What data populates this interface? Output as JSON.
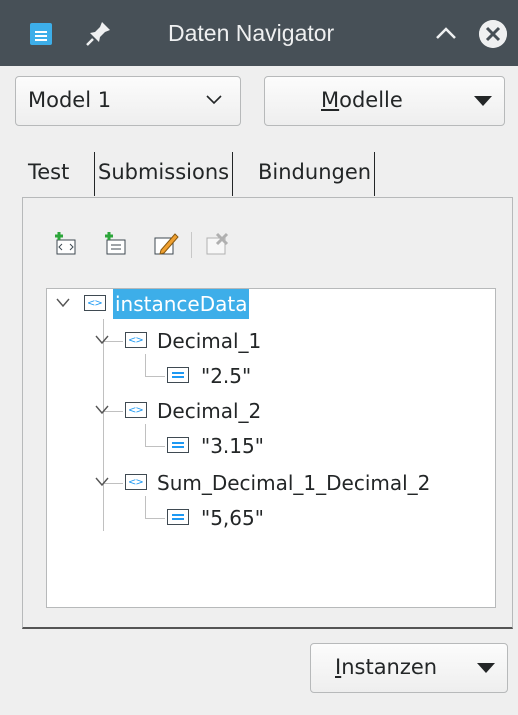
{
  "window": {
    "title": "Daten Navigator",
    "icons": [
      "app-icon",
      "pin-icon",
      "collapse-up-icon",
      "close-icon"
    ]
  },
  "model_select": {
    "value": "Model 1"
  },
  "models_button": {
    "label_mnemonic": "M",
    "label_rest": "odelle"
  },
  "tabs": [
    {
      "label": "Test",
      "active": true
    },
    {
      "label": "Submissions",
      "active": false
    },
    {
      "label": "Bindungen",
      "active": false
    }
  ],
  "toolbar": {
    "icons": [
      "add-item-icon",
      "add-element-icon",
      "edit-icon",
      "delete-icon"
    ]
  },
  "tree": {
    "root": "instanceData",
    "children": [
      {
        "name": "Decimal_1",
        "value": "\"2.5\""
      },
      {
        "name": "Decimal_2",
        "value": "\"3.15\""
      },
      {
        "name": "Sum_Decimal_1_Decimal_2",
        "value": "\"5,65\""
      }
    ]
  },
  "instances_button": {
    "label_mnemonic": "I",
    "label_rest": "nstanzen"
  },
  "colors": {
    "titlebar": "#475057",
    "selection": "#3daee9",
    "accent": "#1d99f3"
  }
}
